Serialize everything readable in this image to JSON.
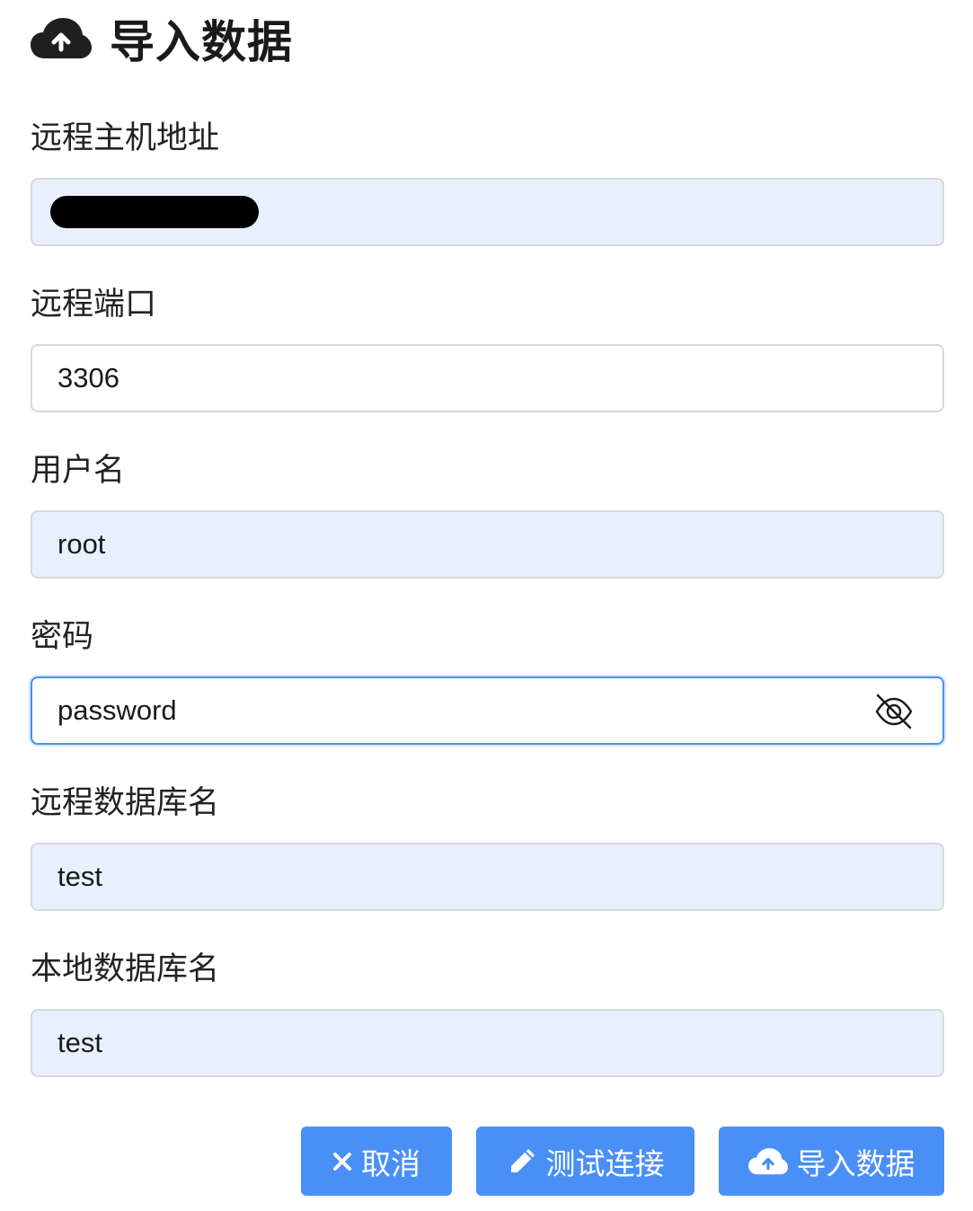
{
  "header": {
    "title": "导入数据",
    "icon": "cloud-upload-icon"
  },
  "form": {
    "host": {
      "label": "远程主机地址",
      "value": ""
    },
    "port": {
      "label": "远程端口",
      "value": "3306"
    },
    "username": {
      "label": "用户名",
      "value": "root"
    },
    "password": {
      "label": "密码",
      "value": "password",
      "toggle_icon": "eye-slash-icon"
    },
    "remote_db": {
      "label": "远程数据库名",
      "value": "test"
    },
    "local_db": {
      "label": "本地数据库名",
      "value": "test"
    }
  },
  "actions": {
    "cancel": {
      "label": "取消",
      "icon": "close-icon"
    },
    "test": {
      "label": "测试连接",
      "icon": "pen-icon"
    },
    "import": {
      "label": "导入数据",
      "icon": "cloud-upload-icon"
    }
  },
  "colors": {
    "accent": "#4a8ff5",
    "autofill_bg": "#e8f0fe",
    "focus_border": "#4a90f0"
  }
}
